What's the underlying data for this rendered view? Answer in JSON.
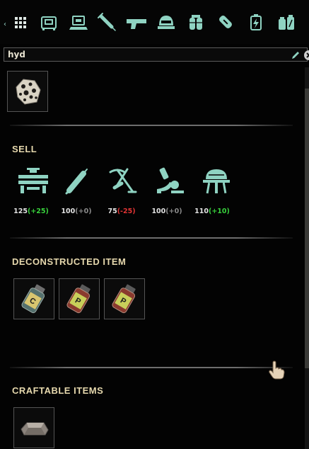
{
  "search": {
    "value": "hyd"
  },
  "category_bar": {
    "arrow": "‹",
    "icons": [
      "grid-icon",
      "storage-icon",
      "computer-icon",
      "syringe-icon",
      "pistol-icon",
      "helmet-icon",
      "backpack-icon",
      "bomb-icon",
      "battery-icon",
      "chemicals-icon"
    ]
  },
  "search_result": {
    "icon": "ore-chunk-icon"
  },
  "sell": {
    "title": "SELL",
    "stations": [
      {
        "icon": "engineering-station-icon",
        "base": "125",
        "delta": "(+25)",
        "tone": "pos"
      },
      {
        "icon": "medical-syringe-station-icon",
        "base": "100",
        "delta": "(+0)",
        "tone": "neu"
      },
      {
        "icon": "mining-station-icon",
        "base": "75",
        "delta": "(-25)",
        "tone": "neg"
      },
      {
        "icon": "research-station-icon",
        "base": "100",
        "delta": "(+0)",
        "tone": "neu"
      },
      {
        "icon": "outpost-station-icon",
        "base": "110",
        "delta": "(+10)",
        "tone": "pos"
      }
    ]
  },
  "deconstructed": {
    "title": "DECONSTRUCTED ITEM",
    "items": [
      "chemical-jar-yellow-icon",
      "chemical-jar-red-icon",
      "chemical-jar-red-icon"
    ]
  },
  "craftable": {
    "title": "CRAFTABLE ITEMS",
    "items": [
      "metal-ingot-icon"
    ]
  },
  "colors": {
    "accent": "#8fd3c2",
    "section_title": "#e6d8ad",
    "positive": "#38d13c",
    "negative": "#e03434",
    "neutral": "#8a8a8a"
  }
}
